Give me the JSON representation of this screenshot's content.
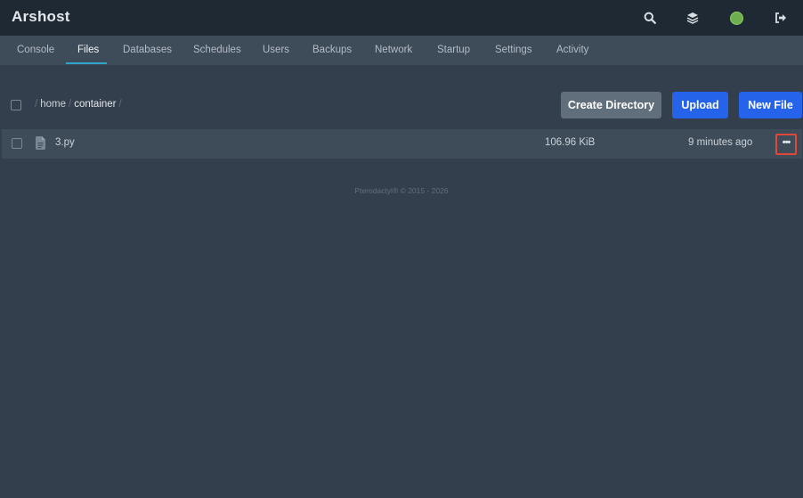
{
  "app": {
    "brand": "Arshost",
    "header_icons": [
      "search-icon",
      "layers-icon",
      "avatar",
      "logout-icon"
    ]
  },
  "nav": {
    "tabs": [
      {
        "label": "Console",
        "active": false
      },
      {
        "label": "Files",
        "active": true
      },
      {
        "label": "Databases",
        "active": false
      },
      {
        "label": "Schedules",
        "active": false
      },
      {
        "label": "Users",
        "active": false
      },
      {
        "label": "Backups",
        "active": false
      },
      {
        "label": "Network",
        "active": false
      },
      {
        "label": "Startup",
        "active": false
      },
      {
        "label": "Settings",
        "active": false
      },
      {
        "label": "Activity",
        "active": false
      }
    ]
  },
  "breadcrumb": {
    "separator": "/",
    "parts": [
      "home",
      "container"
    ]
  },
  "toolbar": {
    "create_directory": "Create Directory",
    "upload": "Upload",
    "new_file": "New File"
  },
  "files": [
    {
      "name": "3.py",
      "size": "106.96 KiB",
      "modified": "9 minutes ago",
      "icon": "file-text-icon"
    }
  ],
  "footer": {
    "text": "Pterodactyl® © 2015 - 2026"
  },
  "colors": {
    "background": "#333f4d",
    "header": "#1f2933",
    "nav": "#3e4c59",
    "accent_blue": "#2563eb",
    "tab_underline": "#2fa3c9",
    "highlight": "#e0483a"
  }
}
